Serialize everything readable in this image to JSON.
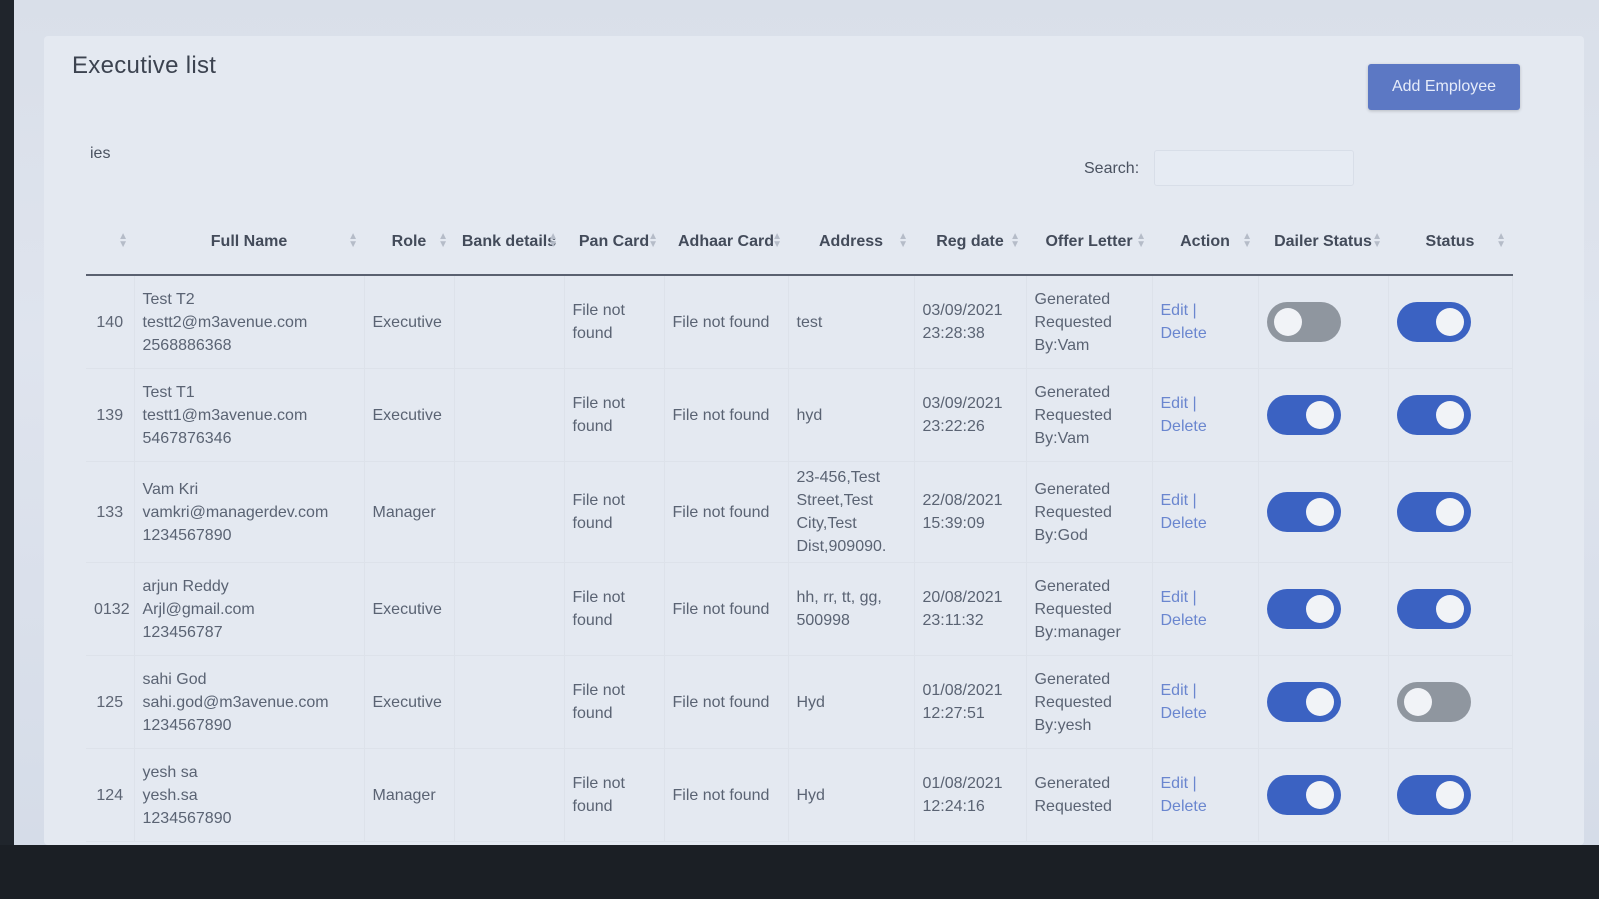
{
  "page": {
    "title": "Executive list",
    "add_button": "Add Employee"
  },
  "controls": {
    "entries_label_partial": "ies",
    "search_label": "Search:",
    "search_value": ""
  },
  "table": {
    "headers": [
      {
        "label": "",
        "key": "id"
      },
      {
        "label": "Full Name",
        "key": "name"
      },
      {
        "label": "Role",
        "key": "role"
      },
      {
        "label": "Bank details",
        "key": "bank"
      },
      {
        "label": "Pan Card",
        "key": "pan"
      },
      {
        "label": "Adhaar Card",
        "key": "adhaar"
      },
      {
        "label": "Address",
        "key": "address"
      },
      {
        "label": "Reg date",
        "key": "reg"
      },
      {
        "label": "Offer Letter",
        "key": "offer"
      },
      {
        "label": "Action",
        "key": "action"
      },
      {
        "label": "Dailer Status",
        "key": "dailer"
      },
      {
        "label": "Status",
        "key": "status"
      }
    ],
    "rows": [
      {
        "id": "140",
        "name": "Test T2",
        "email": "testt2@m3avenue.com",
        "phone": "2568886368",
        "role": "Executive",
        "bank": "",
        "pan": "File not found",
        "adhaar": "File not found",
        "address": "test",
        "reg_date": "03/09/2021",
        "reg_time": "23:28:38",
        "offer_status": "Generated",
        "offer_requested": "Requested By:Vam",
        "edit": "Edit |",
        "delete": "Delete",
        "dailer_on": false,
        "status_on": true
      },
      {
        "id": "139",
        "name": "Test T1",
        "email": "testt1@m3avenue.com",
        "phone": "5467876346",
        "role": "Executive",
        "bank": "",
        "pan": "File not found",
        "adhaar": "File not found",
        "address": "hyd",
        "reg_date": "03/09/2021",
        "reg_time": "23:22:26",
        "offer_status": "Generated",
        "offer_requested": "Requested By:Vam",
        "edit": "Edit |",
        "delete": "Delete",
        "dailer_on": true,
        "status_on": true
      },
      {
        "id": "133",
        "name": "Vam Kri",
        "email": "vamkri@managerdev.com",
        "phone": "1234567890",
        "role": "Manager",
        "bank": "",
        "pan": "File not found",
        "adhaar": "File not found",
        "address": "23-456,Test Street,Test City,Test Dist,909090.",
        "reg_date": "22/08/2021",
        "reg_time": "15:39:09",
        "offer_status": "Generated",
        "offer_requested": "Requested By:God",
        "edit": "Edit |",
        "delete": "Delete",
        "dailer_on": true,
        "status_on": true
      },
      {
        "id": "0132",
        "name": "arjun Reddy",
        "email": "Arjl@gmail.com",
        "phone": "123456787",
        "role": "Executive",
        "bank": "",
        "pan": "File not found",
        "adhaar": "File not found",
        "address": "hh, rr, tt, gg, 500998",
        "reg_date": "20/08/2021",
        "reg_time": "23:11:32",
        "offer_status": "Generated",
        "offer_requested": "Requested By:manager",
        "edit": "Edit |",
        "delete": "Delete",
        "dailer_on": true,
        "status_on": true
      },
      {
        "id": "125",
        "name": "sahi God",
        "email": "sahi.god@m3avenue.com",
        "phone": "1234567890",
        "role": "Executive",
        "bank": "",
        "pan": "File not found",
        "adhaar": "File not found",
        "address": "Hyd",
        "reg_date": "01/08/2021",
        "reg_time": "12:27:51",
        "offer_status": "Generated",
        "offer_requested": "Requested By:yesh",
        "edit": "Edit |",
        "delete": "Delete",
        "dailer_on": true,
        "status_on": false
      },
      {
        "id": "124",
        "name": "yesh sa",
        "email": "yesh.sa",
        "phone": "1234567890",
        "role": "Manager",
        "bank": "",
        "pan": "File not found",
        "adhaar": "File not found",
        "address": "Hyd",
        "reg_date": "01/08/2021",
        "reg_time": "12:24:16",
        "offer_status": "Generated",
        "offer_requested": "Requested",
        "edit": "Edit |",
        "delete": "Delete",
        "dailer_on": true,
        "status_on": true
      }
    ]
  },
  "colors": {
    "toggle_on": "#3b62c2",
    "toggle_off": "#8f969f",
    "link": "#6a86cf",
    "button": "#5c78c4"
  }
}
